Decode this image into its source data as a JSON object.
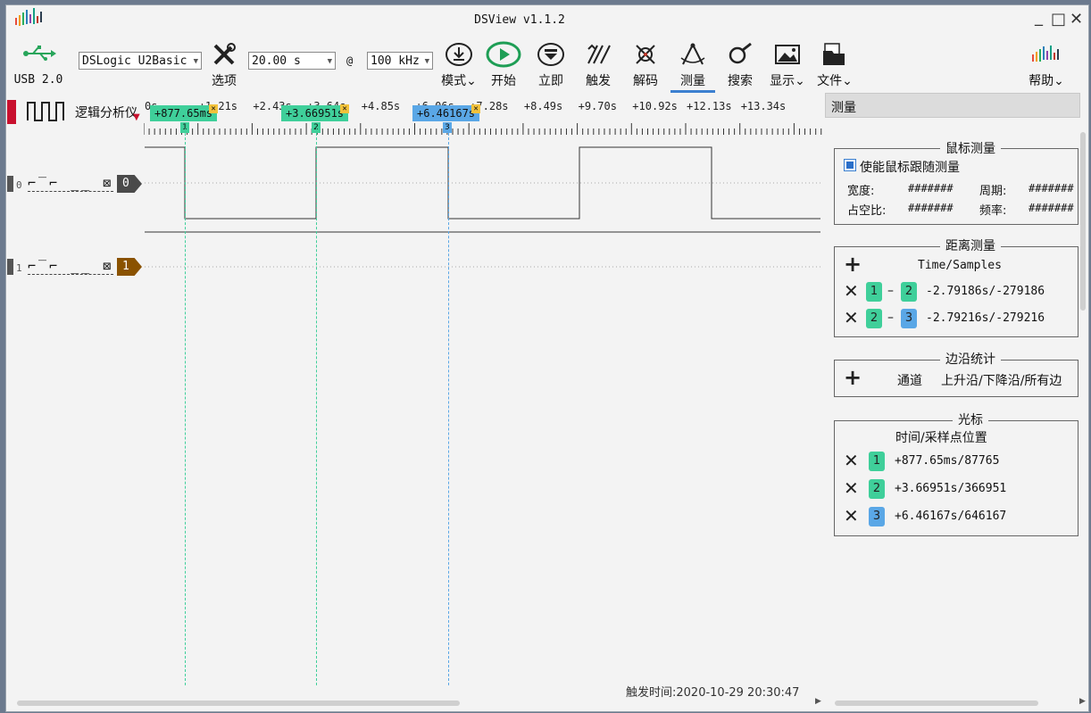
{
  "window": {
    "title": "DSView v1.1.2",
    "min": "_",
    "max": "□",
    "close": "✕"
  },
  "toolbar": {
    "usb_label": "USB 2.0",
    "device": "DSLogic U2Basic",
    "options_label": "选项",
    "duration": "20.00 s",
    "at": "@",
    "rate": "100 kHz",
    "mode_label": "模式⌄",
    "start_label": "开始",
    "instant_label": "立即",
    "trigger_label": "触发",
    "decode_label": "解码",
    "measure_label": "测量",
    "search_label": "搜索",
    "display_label": "显示⌄",
    "file_label": "文件⌄",
    "help_label": "帮助⌄"
  },
  "ruler": {
    "mode_label": "逻辑分析仪",
    "ticks": [
      "0s",
      "+1.21s",
      "+2.43s",
      "+3.64s",
      "+4.85s",
      "+6.06s",
      "+7.28s",
      "+8.49s",
      "+9.70s",
      "+10.92s",
      "+12.13s",
      "+13.34s"
    ],
    "cursor_chips": [
      {
        "label": "+877.65ms",
        "num": "1",
        "color": "#3fcf9a"
      },
      {
        "label": "+3.66951s",
        "num": "2",
        "color": "#3fcf9a"
      },
      {
        "label": "+6.46167s",
        "num": "3",
        "color": "#5aa7e6"
      }
    ]
  },
  "channels": [
    {
      "index": "0",
      "tag": "0",
      "tag_color": "#4a4a4a"
    },
    {
      "index": "1",
      "tag": "1",
      "tag_color": "#8a5200"
    }
  ],
  "status": {
    "trigger_time": "触发时间:2020-10-29 20:30:47"
  },
  "panel": {
    "header": "测量",
    "mouse": {
      "title": "鼠标测量",
      "enable_label": "使能鼠标跟随测量",
      "enabled": true,
      "width_label": "宽度:",
      "width_value": "#######",
      "period_label": "周期:",
      "period_value": "#######",
      "duty_label": "占空比:",
      "duty_value": "#######",
      "freq_label": "频率:",
      "freq_value": "#######"
    },
    "distance": {
      "title": "距离测量",
      "header": "Time/Samples",
      "rows": [
        {
          "a": "1",
          "a_color": "#3fcf9a",
          "b": "2",
          "b_color": "#3fcf9a",
          "value": "-2.79186s/-279186"
        },
        {
          "a": "2",
          "a_color": "#3fcf9a",
          "b": "3",
          "b_color": "#5aa7e6",
          "value": "-2.79216s/-279216"
        }
      ]
    },
    "edges": {
      "title": "边沿统计",
      "channel_label": "通道",
      "edges_label": "上升沿/下降沿/所有边"
    },
    "cursors": {
      "title": "光标",
      "header": "时间/采样点位置",
      "rows": [
        {
          "num": "1",
          "color": "#3fcf9a",
          "value": "+877.65ms/87765"
        },
        {
          "num": "2",
          "color": "#3fcf9a",
          "value": "+3.66951s/366951"
        },
        {
          "num": "3",
          "color": "#5aa7e6",
          "value": "+6.46167s/646167"
        }
      ]
    }
  }
}
